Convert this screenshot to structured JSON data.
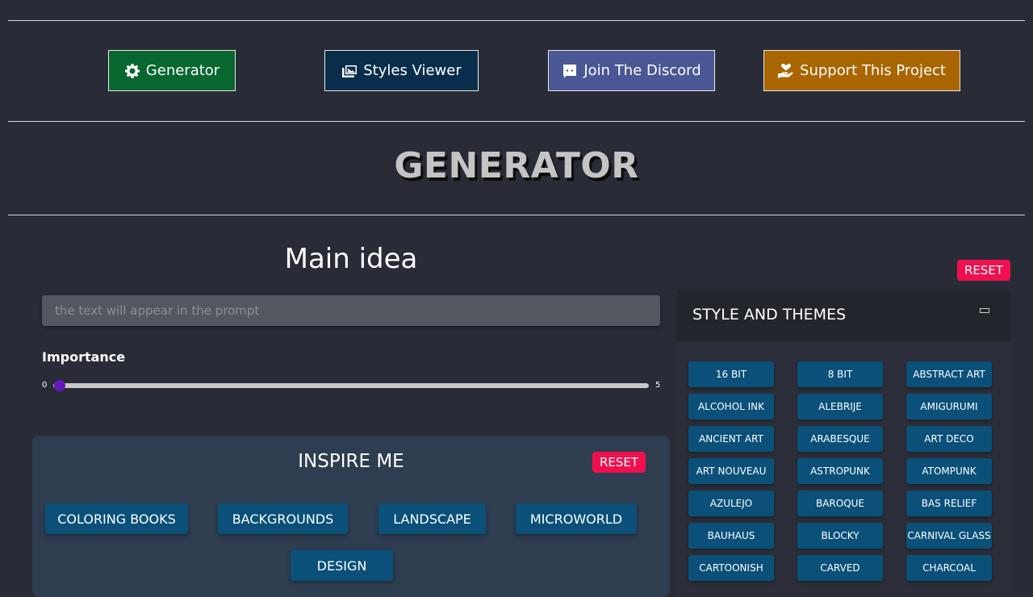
{
  "nav": {
    "generator": "Generator",
    "styles_viewer": "Styles Viewer",
    "discord": "Join The Discord",
    "support": "Support This Project"
  },
  "colors": {
    "generator_bg": "#07672f",
    "styles_bg": "#082e4b",
    "discord_bg": "#495794",
    "support_bg": "#a96500",
    "reset_bg": "#f0104f",
    "chip_bg": "#0a5079",
    "slider_thumb": "#6417b8"
  },
  "page_title": "GENERATOR",
  "main_idea": {
    "heading": "Main idea",
    "placeholder": "the text will appear in the prompt",
    "importance_label": "Importance",
    "slider_min": "0",
    "slider_max": "5",
    "slider_value": 0
  },
  "inspire": {
    "title": "INSPIRE ME",
    "reset": "RESET",
    "buttons": [
      "COLORING BOOKS",
      "BACKGROUNDS",
      "LANDSCAPE",
      "MICROWORLD",
      "DESIGN"
    ]
  },
  "styles": {
    "reset": "RESET",
    "title": "STYLE AND THEMES",
    "items": [
      "16 BIT",
      "8 BIT",
      "ABSTRACT ART",
      "ALCOHOL INK",
      "ALEBRIJE",
      "AMIGURUMI",
      "ANCIENT ART",
      "ARABESQUE",
      "ART DECO",
      "ART NOUVEAU",
      "ASTROPUNK",
      "ATOMPUNK",
      "AZULEJO",
      "BAROQUE",
      "BAS RELIEF",
      "BAUHAUS",
      "BLOCKY",
      "CARNIVAL GLASS",
      "CARTOONISH",
      "CARVED",
      "CHARCOAL"
    ]
  }
}
